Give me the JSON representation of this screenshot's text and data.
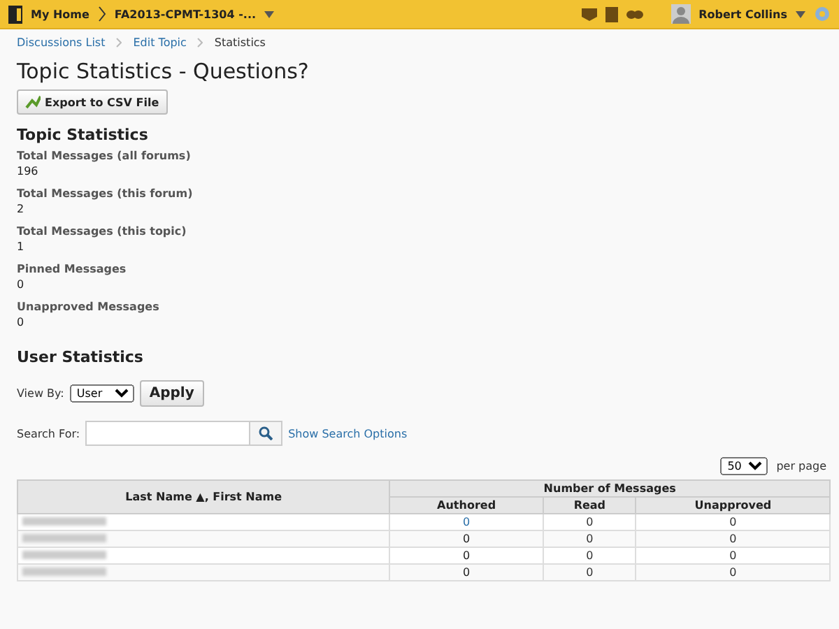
{
  "navbar": {
    "home": "My Home",
    "course": "FA2013-CPMT-1304 -...",
    "user": "Robert Collins"
  },
  "breadcrumbs": [
    {
      "label": "Discussions List",
      "link": true
    },
    {
      "label": "Edit Topic",
      "link": true
    },
    {
      "label": "Statistics",
      "link": false
    }
  ],
  "title": "Topic Statistics - Questions?",
  "export_button": "Export to CSV File",
  "topic_statistics": {
    "heading": "Topic Statistics",
    "items": [
      {
        "label": "Total Messages (all forums)",
        "value": "196"
      },
      {
        "label": "Total Messages (this forum)",
        "value": "2"
      },
      {
        "label": "Total Messages (this topic)",
        "value": "1"
      },
      {
        "label": "Pinned Messages",
        "value": "0"
      },
      {
        "label": "Unapproved Messages",
        "value": "0"
      }
    ]
  },
  "user_statistics": {
    "heading": "User Statistics",
    "view_by_label": "View By:",
    "view_by_value": "User",
    "apply_button": "Apply",
    "search_label": "Search For:",
    "search_options_link": "Show Search Options",
    "page_size": "50",
    "per_page_label": "per page"
  },
  "table": {
    "name_column": "Last Name ▲, First Name",
    "group_column": "Number of Messages",
    "columns": [
      "Authored",
      "Read",
      "Unapproved"
    ],
    "rows": [
      {
        "authored": "0",
        "authored_link": true,
        "read": "0",
        "unapproved": "0"
      },
      {
        "authored": "0",
        "authored_link": false,
        "read": "0",
        "unapproved": "0"
      },
      {
        "authored": "0",
        "authored_link": false,
        "read": "0",
        "unapproved": "0"
      },
      {
        "authored": "0",
        "authored_link": false,
        "read": "0",
        "unapproved": "0"
      }
    ]
  }
}
